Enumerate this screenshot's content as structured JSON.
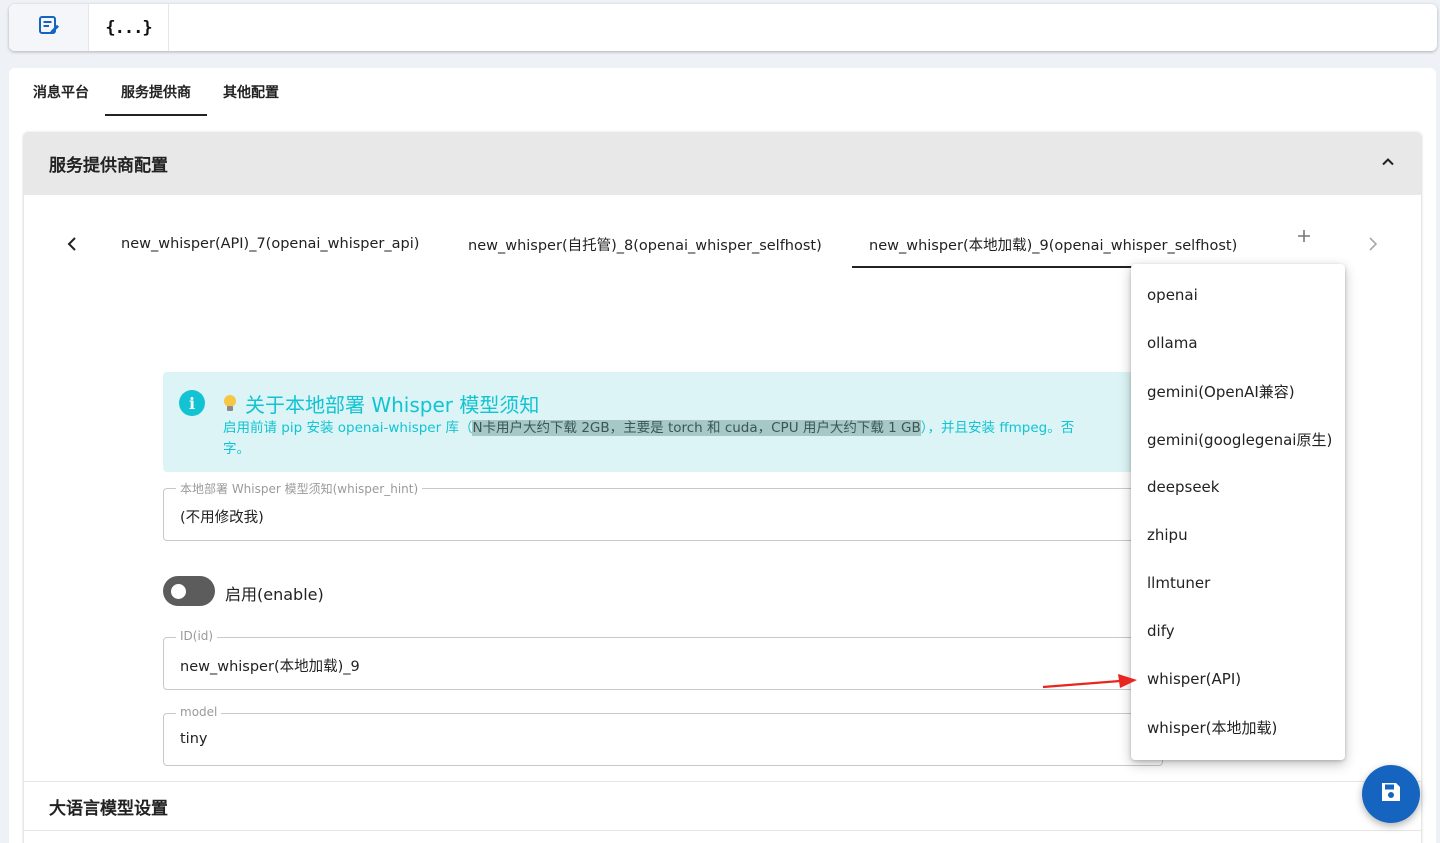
{
  "modebar": {
    "items": [
      {
        "icon": "form-edit-icon"
      },
      {
        "icon": "code-braces-icon",
        "glyph": "{...}"
      }
    ]
  },
  "platform_tabs": [
    {
      "label": "消息平台",
      "active": false
    },
    {
      "label": "服务提供商",
      "active": true
    },
    {
      "label": "其他配置",
      "active": false
    }
  ],
  "provider_section": {
    "title": "服务提供商配置",
    "tabs": [
      {
        "label": "new_whisper(API)_7(openai_whisper_api)",
        "active": false
      },
      {
        "label": "new_whisper(自托管)_8(openai_whisper_selfhost)",
        "active": false
      },
      {
        "label": "new_whisper(本地加载)_9(openai_whisper_selfhost)",
        "active": true
      }
    ],
    "alert": {
      "title": "关于本地部署 Whisper 模型须知",
      "body_prefix": "启用前请 pip 安装 openai-whisper 库（",
      "body_highlight": "N卡用户大约下载 2GB，主要是 torch 和 cuda，CPU 用户大约下载 1 GB",
      "body_suffix": "），并且安装 ffmpeg。否",
      "body_line2": "字。"
    },
    "fields": {
      "whisper_hint": {
        "label": "本地部署 Whisper 模型须知(whisper_hint)",
        "value": "(不用修改我)"
      },
      "enable": {
        "label": "启用(enable)",
        "checked": false
      },
      "id": {
        "label": "ID(id)",
        "value": "new_whisper(本地加载)_9"
      },
      "model": {
        "label": "model",
        "value": "tiny"
      }
    }
  },
  "llm_section": {
    "title": "大语言模型设置"
  },
  "add_menu": {
    "items": [
      "openai",
      "ollama",
      "gemini(OpenAI兼容)",
      "gemini(googlegenai原生)",
      "deepseek",
      "zhipu",
      "llmtuner",
      "dify",
      "whisper(API)",
      "whisper(本地加载)"
    ],
    "pointed_item": "whisper(API)",
    "arrow_color": "#e8261f"
  },
  "fab": {
    "icon": "save-icon",
    "color": "#1565c0"
  }
}
